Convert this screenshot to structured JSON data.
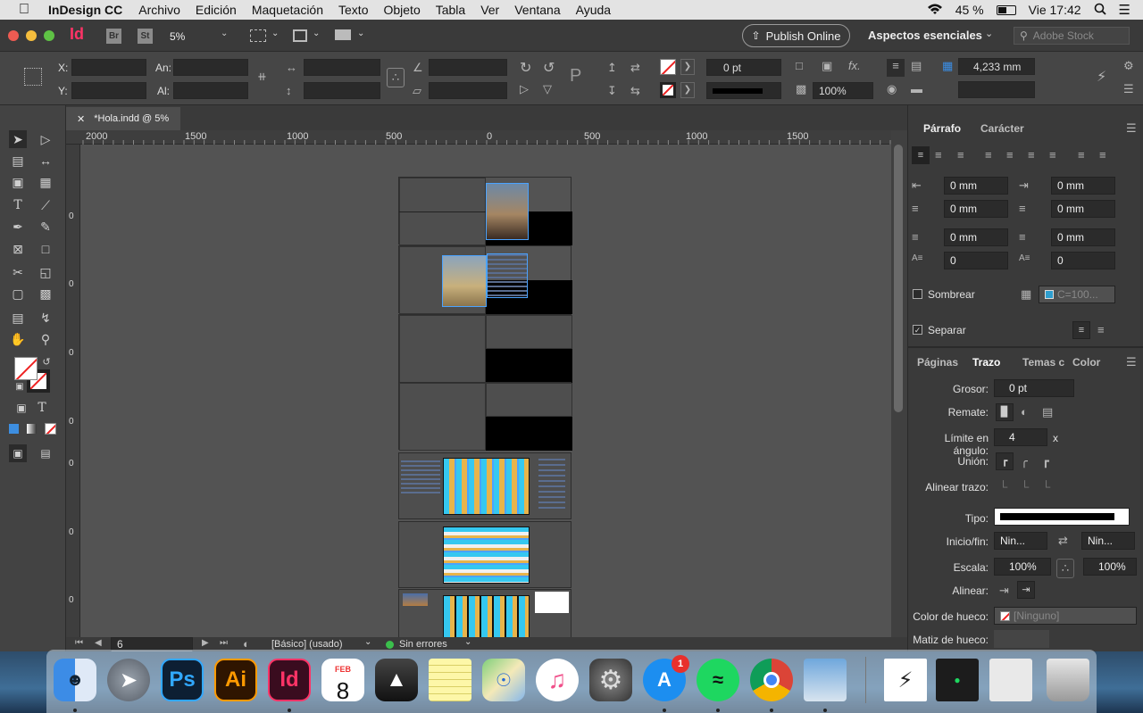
{
  "menubar": {
    "app_name": "InDesign CC",
    "items": [
      "Archivo",
      "Edición",
      "Maquetación",
      "Texto",
      "Objeto",
      "Tabla",
      "Ver",
      "Ventana",
      "Ayuda"
    ],
    "battery": "45 %",
    "clock": "Vie 17:42"
  },
  "appbar": {
    "app_badge": "Id",
    "bridge": "Br",
    "stock": "St",
    "zoom": "5%",
    "publish_online": "Publish Online",
    "workspace": "Aspectos esenciales",
    "search_placeholder": "Adobe Stock"
  },
  "control": {
    "x_label": "X:",
    "y_label": "Y:",
    "w_label": "An:",
    "h_label": "Al:",
    "stroke_weight": "0 pt",
    "scale": "100%",
    "column_size": "4,233 mm",
    "fx": "fx."
  },
  "document": {
    "tab_title": "*Hola.indd @ 5%",
    "ruler_labels": [
      "2000",
      "1500",
      "1000",
      "500",
      "0",
      "500",
      "1000",
      "1500"
    ],
    "vruler_labels": [
      "0",
      "0",
      "0",
      "0",
      "0",
      "0",
      "0"
    ],
    "page_number": "6",
    "master": "[Básico] (usado)",
    "preflight": "Sin errores"
  },
  "paragraph_panel": {
    "tabs": [
      "Párrafo",
      "Carácter"
    ],
    "left_indent": "0 mm",
    "right_indent": "0 mm",
    "first_line_indent": "0 mm",
    "last_line_indent": "0 mm",
    "space_before": "0 mm",
    "space_after": "0 mm",
    "drop_cap_lines": "0",
    "drop_cap_chars": "0",
    "shading_label": "Sombrear",
    "shading_swatch": "C=100...",
    "separate_label": "Separar"
  },
  "stroke_panel": {
    "tabs": [
      "Páginas",
      "Trazo",
      "Temas c",
      "Color"
    ],
    "weight_label": "Grosor:",
    "weight": "0 pt",
    "cap_label": "Remate:",
    "miter_label": "Límite en ángulo:",
    "miter": "4",
    "miter_unit": "x",
    "join_label": "Unión:",
    "align_label": "Alinear trazo:",
    "type_label": "Tipo:",
    "startend_label": "Inicio/fin:",
    "start": "Nin...",
    "end": "Nin...",
    "scale_label": "Escala:",
    "scale_start": "100%",
    "scale_end": "100%",
    "align2_label": "Alinear:",
    "gap_color_label": "Color de hueco:",
    "gap_color": "[Ninguno]",
    "gap_tint_label": "Matiz de hueco:"
  },
  "dock": {
    "calendar_month": "FEB",
    "calendar_day": "8",
    "appstore_badge": "1",
    "ps": "Ps",
    "ai": "Ai",
    "id": "Id"
  },
  "colors": {
    "accent_indesign": "#ff3366",
    "panel_bg": "#3a3a3a",
    "pasteboard": "#535353"
  }
}
